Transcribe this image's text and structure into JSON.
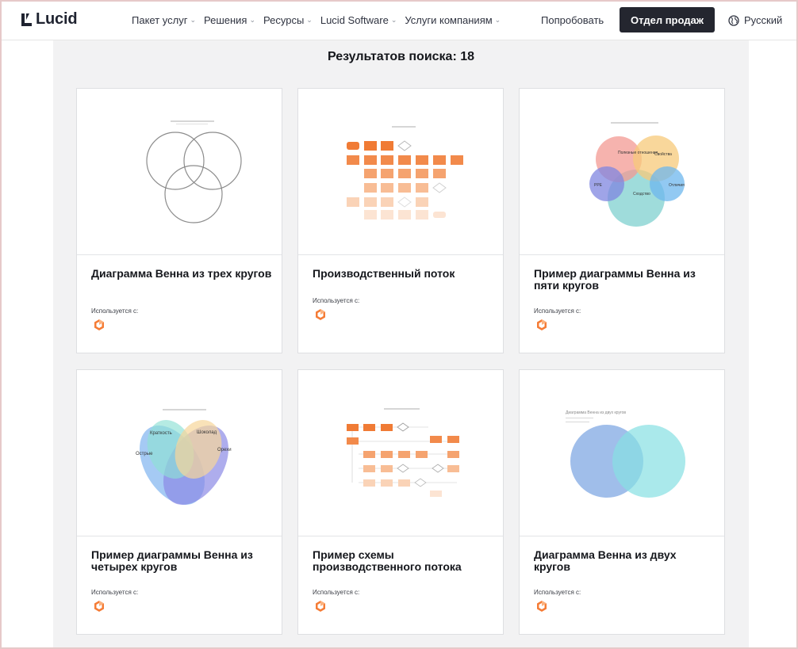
{
  "header": {
    "logo_text": "Lucid",
    "nav": [
      {
        "label": "Пакет услуг"
      },
      {
        "label": "Решения"
      },
      {
        "label": "Ресурсы"
      },
      {
        "label": "Lucid Software"
      },
      {
        "label": "Услуги компаниям"
      }
    ],
    "try_label": "Попробовать",
    "sales_label": "Отдел продаж",
    "language_label": "Русский"
  },
  "results": {
    "title": "Результатов поиска: 18"
  },
  "cards": [
    {
      "title": "Диаграмма Венна из трех кругов",
      "used_with": "Используется с:"
    },
    {
      "title": "Производственный поток",
      "used_with": "Используется с:"
    },
    {
      "title": "Пример диаграммы Венна из пяти кругов",
      "used_with": "Используется с:"
    },
    {
      "title": "Пример диаграммы Венна из четырех кругов",
      "used_with": "Используется с:"
    },
    {
      "title": "Пример схемы производственного потока",
      "used_with": "Используется с:"
    },
    {
      "title": "Диаграмма Венна из двух кругов",
      "used_with": "Используется с:"
    }
  ],
  "thumbnail_labels": {
    "four_circle": [
      "Краткость",
      "Шоколад",
      "Острые",
      "Орехи"
    ],
    "five_circle": [
      "Полезные отношения",
      "Свойства",
      "PPE",
      "Отличия",
      "Сходство"
    ],
    "two_circle": [
      "Диаграмма Венна из двух кругов"
    ]
  },
  "colors": {
    "accent_orange": "#f57c36",
    "dark_button": "#24262f",
    "page_bg": "#f2f2f3"
  }
}
